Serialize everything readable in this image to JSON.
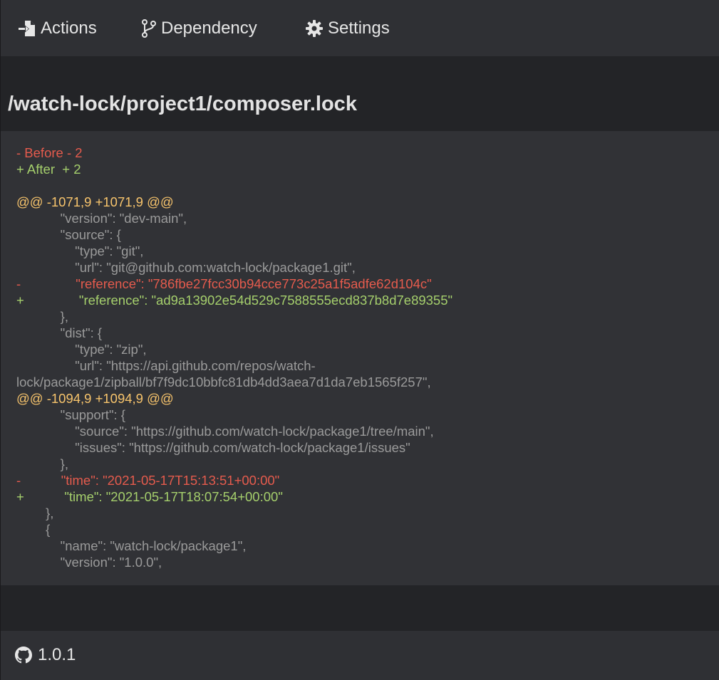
{
  "nav": {
    "items": [
      {
        "label": "Actions",
        "icon": "file-import-icon"
      },
      {
        "label": "Dependency",
        "icon": "branch-icon"
      },
      {
        "label": "Settings",
        "icon": "gear-icon"
      }
    ]
  },
  "page": {
    "title": "/watch-lock/project1/composer.lock"
  },
  "diff": {
    "colors": {
      "deletion": "#e55b4d",
      "addition": "#a5cf6c",
      "hunk": "#f7c46c",
      "context": "#9a9a9a"
    },
    "lines": [
      {
        "type": "del",
        "text": "- Before - 2"
      },
      {
        "type": "add",
        "text": "+ After  + 2"
      },
      {
        "type": "ctx",
        "text": ""
      },
      {
        "type": "hunk",
        "text": "@@ -1071,9 +1071,9 @@"
      },
      {
        "type": "ctx",
        "text": "            \"version\": \"dev-main\","
      },
      {
        "type": "ctx",
        "text": "            \"source\": {"
      },
      {
        "type": "ctx",
        "text": "                \"type\": \"git\","
      },
      {
        "type": "ctx",
        "text": "                \"url\": \"git@github.com:watch-lock/package1.git\","
      },
      {
        "type": "del",
        "text": "-               \"reference\": \"786fbe27fcc30b94cce773c25a1f5adfe62d104c\""
      },
      {
        "type": "add",
        "text": "+               \"reference\": \"ad9a13902e54d529c7588555ecd837b8d7e89355\""
      },
      {
        "type": "ctx",
        "text": "            },"
      },
      {
        "type": "ctx",
        "text": "            \"dist\": {"
      },
      {
        "type": "ctx",
        "text": "                \"type\": \"zip\","
      },
      {
        "type": "ctx",
        "text": "                \"url\": \"https://api.github.com/repos/watch-"
      },
      {
        "type": "ctx",
        "text": "lock/package1/zipball/bf7f9dc10bbfc81db4dd3aea7d1da7eb1565f257\","
      },
      {
        "type": "hunk",
        "text": "@@ -1094,9 +1094,9 @@"
      },
      {
        "type": "ctx",
        "text": "            \"support\": {"
      },
      {
        "type": "ctx",
        "text": "                \"source\": \"https://github.com/watch-lock/package1/tree/main\","
      },
      {
        "type": "ctx",
        "text": "                \"issues\": \"https://github.com/watch-lock/package1/issues\""
      },
      {
        "type": "ctx",
        "text": "            },"
      },
      {
        "type": "del",
        "text": "-           \"time\": \"2021-05-17T15:13:51+00:00\""
      },
      {
        "type": "add",
        "text": "+           \"time\": \"2021-05-17T18:07:54+00:00\""
      },
      {
        "type": "ctx",
        "text": "        },"
      },
      {
        "type": "ctx",
        "text": "        {"
      },
      {
        "type": "ctx",
        "text": "            \"name\": \"watch-lock/package1\","
      },
      {
        "type": "ctx",
        "text": "            \"version\": \"1.0.0\","
      }
    ]
  },
  "footer": {
    "version": "1.0.1",
    "icon": "github-icon"
  }
}
